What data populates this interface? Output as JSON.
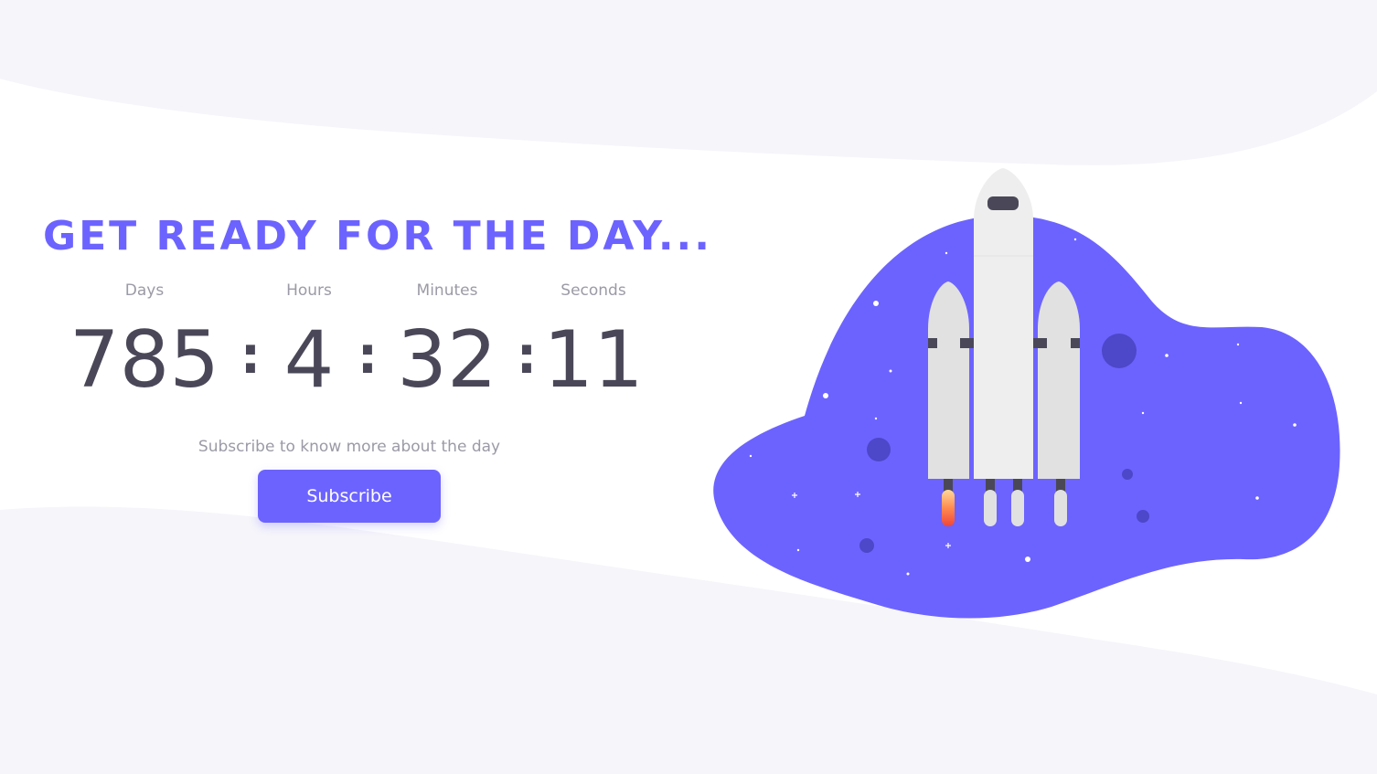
{
  "headline": "GET READY FOR THE DAY...",
  "countdown": {
    "days": {
      "label": "Days",
      "value": "785"
    },
    "hours": {
      "label": "Hours",
      "value": "4"
    },
    "minutes": {
      "label": "Minutes",
      "value": "32"
    },
    "seconds": {
      "label": "Seconds",
      "value": "11"
    },
    "separator": ":"
  },
  "subscribe": {
    "prompt": "Subscribe to know more about the day",
    "button_label": "Subscribe"
  },
  "colors": {
    "accent": "#6c63ff",
    "text_dark": "#4a4858",
    "text_muted": "#9b9aa6",
    "bg_wave": "#f5f5fa"
  },
  "icons": {
    "illustration": "rocket-launch-illustration"
  }
}
